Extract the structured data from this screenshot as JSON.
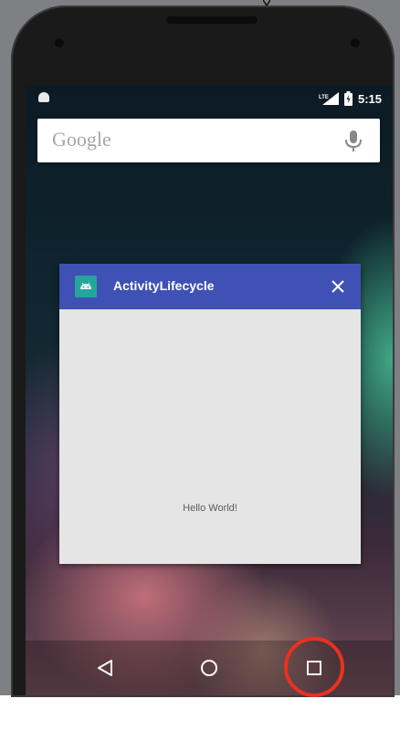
{
  "status_bar": {
    "network_label": "LTE",
    "battery_label": "",
    "time": "5:15"
  },
  "search": {
    "placeholder_text": "Google",
    "mic_icon": "microphone-icon"
  },
  "recent_app": {
    "title": "ActivityLifecycle",
    "content_text": "Hello World!",
    "header_color": "#3f51b5",
    "icon_color": "#26a69a"
  },
  "nav": {
    "back_icon": "back-triangle-icon",
    "home_icon": "home-circle-icon",
    "recents_icon": "recents-square-icon"
  },
  "annotation": {
    "highlight_color": "#e8321f"
  }
}
